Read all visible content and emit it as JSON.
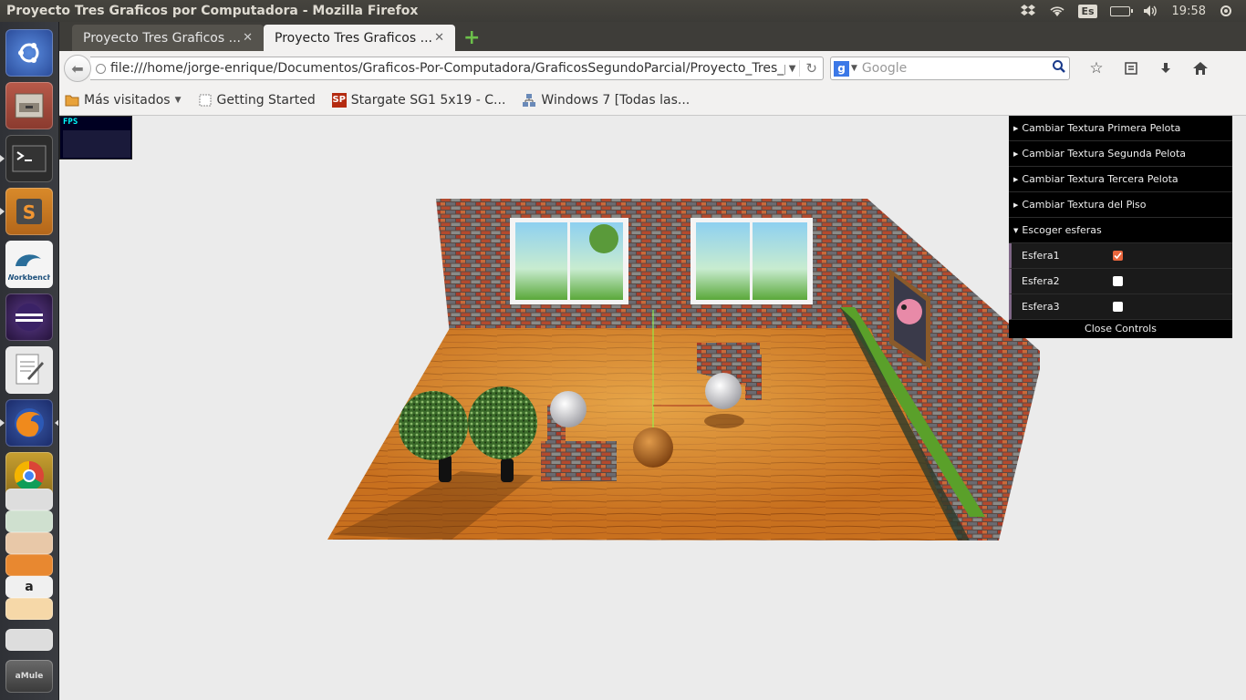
{
  "top_panel": {
    "title": "Proyecto Tres Graficos por Computadora - Mozilla Firefox",
    "keyboard": "Es",
    "clock": "19:58"
  },
  "launcher": {
    "apps": [
      "ubuntu-dash",
      "files",
      "terminal",
      "sublime-text",
      "mysql-workbench",
      "eclipse",
      "text-editor",
      "firefox",
      "chrome",
      "libreoffice-writer",
      "libreoffice-calc",
      "libreoffice-impress",
      "software-center",
      "amazon",
      "mail",
      "vmware",
      "amule"
    ],
    "workbench_label": "Workbench",
    "amule_label": "aMule"
  },
  "tabs": [
    {
      "label": "Proyecto Tres Graficos ...",
      "active": false
    },
    {
      "label": "Proyecto Tres Graficos ...",
      "active": true
    }
  ],
  "navbar": {
    "url": "file:///home/jorge-enrique/Documentos/Graficos-Por-Computadora/GraficosSegundoParcial/Proyecto_Tres_p",
    "search_placeholder": "Google",
    "search_engine_letter": "g"
  },
  "bookmarks": [
    {
      "label": "Más visitados",
      "dropdown": true,
      "icon": "folder-icon"
    },
    {
      "label": "Getting Started",
      "icon": "page-icon"
    },
    {
      "label": "Stargate SG1 5x19 - C...",
      "icon": "sp-icon"
    },
    {
      "label": "Windows 7 [Todas las...",
      "icon": "network-icon"
    }
  ],
  "fps": {
    "label": "FPS"
  },
  "gui": {
    "folders": [
      "Cambiar Textura Primera Pelota",
      "Cambiar Textura Segunda Pelota",
      "Cambiar Textura Tercera Pelota",
      "Cambiar Textura del Piso",
      "Escoger esferas"
    ],
    "rows": [
      {
        "label": "Esfera1",
        "checked": true
      },
      {
        "label": "Esfera2",
        "checked": false
      },
      {
        "label": "Esfera3",
        "checked": false
      }
    ],
    "close_label": "Close Controls",
    "accent": "#806787",
    "check_color": "#e8663d"
  }
}
